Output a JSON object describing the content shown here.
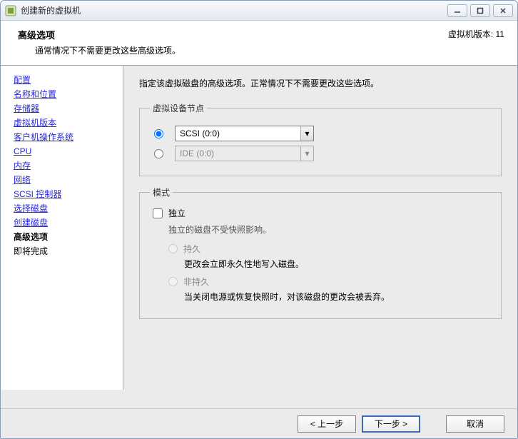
{
  "window": {
    "title": "创建新的虚拟机"
  },
  "header": {
    "title": "高级选项",
    "subtitle": "通常情况下不需要更改这些高级选项。",
    "version": "虚拟机版本: 11"
  },
  "sidebar": {
    "items": [
      {
        "label": "配置"
      },
      {
        "label": "名称和位置"
      },
      {
        "label": "存储器"
      },
      {
        "label": "虚拟机版本"
      },
      {
        "label": "客户机操作系统"
      },
      {
        "label": "CPU"
      },
      {
        "label": "内存"
      },
      {
        "label": "网络"
      },
      {
        "label": "SCSI 控制器"
      },
      {
        "label": "选择磁盘"
      },
      {
        "label": "创建磁盘"
      }
    ],
    "current": "高级选项",
    "next": "即将完成"
  },
  "main": {
    "instruction": "指定该虚拟磁盘的高级选项。正常情况下不需要更改这些选项。",
    "node_legend": "虚拟设备节点",
    "node_scsi": "SCSI (0:0)",
    "node_ide": "IDE (0:0)",
    "mode_legend": "模式",
    "independent_label": "独立",
    "independent_desc": "独立的磁盘不受快照影响。",
    "persistent_label": "持久",
    "persistent_desc": "更改会立即永久性地写入磁盘。",
    "nonpersistent_label": "非持久",
    "nonpersistent_desc": "当关闭电源或恢复快照时，对该磁盘的更改会被丢弃。"
  },
  "footer": {
    "back": "< 上一步",
    "next": "下一步 >",
    "cancel": "取消"
  }
}
